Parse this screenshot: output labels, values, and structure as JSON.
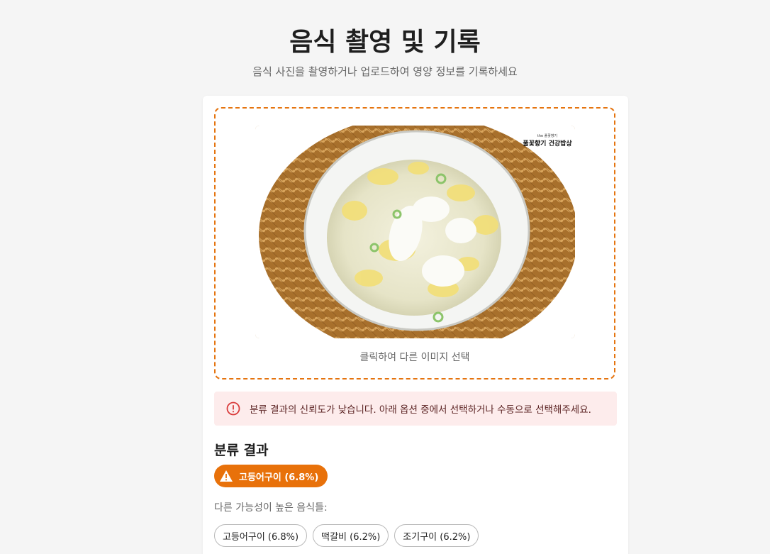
{
  "header": {
    "title": "음식 촬영 및 기록",
    "subtitle": "음식 사진을 촬영하거나 업로드하여 영양 정보를 기록하세요"
  },
  "upload": {
    "change_image_label": "클릭하여 다른 이미지 선택",
    "watermark_brand": "풀꽃향기 건강밥상"
  },
  "alert": {
    "icon": "alert-circle-icon",
    "message": "분류 결과의 신뢰도가 낮습니다. 아래 옵션 중에서 선택하거나 수동으로 선택해주세요.",
    "color": "#d93b3b",
    "background": "#fdecec"
  },
  "classification": {
    "section_title": "분류 결과",
    "top_result": {
      "label": "고등어구이 (6.8%)",
      "icon": "warning-triangle-icon",
      "color": "#e8710a"
    },
    "alternatives_label": "다른 가능성이 높은 음식들:",
    "alternatives": [
      {
        "label": "고등어구이 (6.8%)"
      },
      {
        "label": "떡갈비 (6.2%)"
      },
      {
        "label": "조기구이 (6.2%)"
      }
    ]
  },
  "colors": {
    "accent": "#e5740f",
    "page_background": "#f5f5f5",
    "card_background": "#ffffff"
  }
}
